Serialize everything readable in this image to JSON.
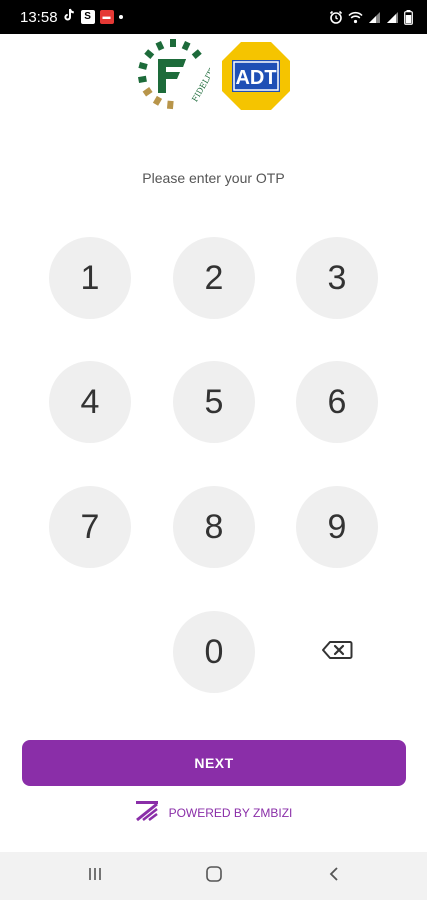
{
  "status_bar": {
    "time": "13:58",
    "s_badge": "S",
    "icons": [
      "tiktok-icon",
      "s-app-icon",
      "red-app-icon",
      "dot-icon",
      "alarm-icon",
      "wifi-icon",
      "signal-icon",
      "signal-icon",
      "battery-icon"
    ]
  },
  "logos": {
    "fidelity_text": "FIDELITY",
    "adt_text": "ADT"
  },
  "prompt": "Please enter your OTP",
  "keypad": {
    "keys": [
      "1",
      "2",
      "3",
      "4",
      "5",
      "6",
      "7",
      "8",
      "9",
      "0"
    ],
    "backspace_icon": "backspace-icon"
  },
  "next_label": "NEXT",
  "powered_by": "POWERED BY ZMBIZI",
  "colors": {
    "accent": "#8a2ea8",
    "key_bg": "#efefef",
    "adt_yellow": "#f5c400",
    "adt_blue": "#1e4fb5",
    "fidelity_green": "#1d6b3a",
    "fidelity_gold": "#b8954a"
  }
}
